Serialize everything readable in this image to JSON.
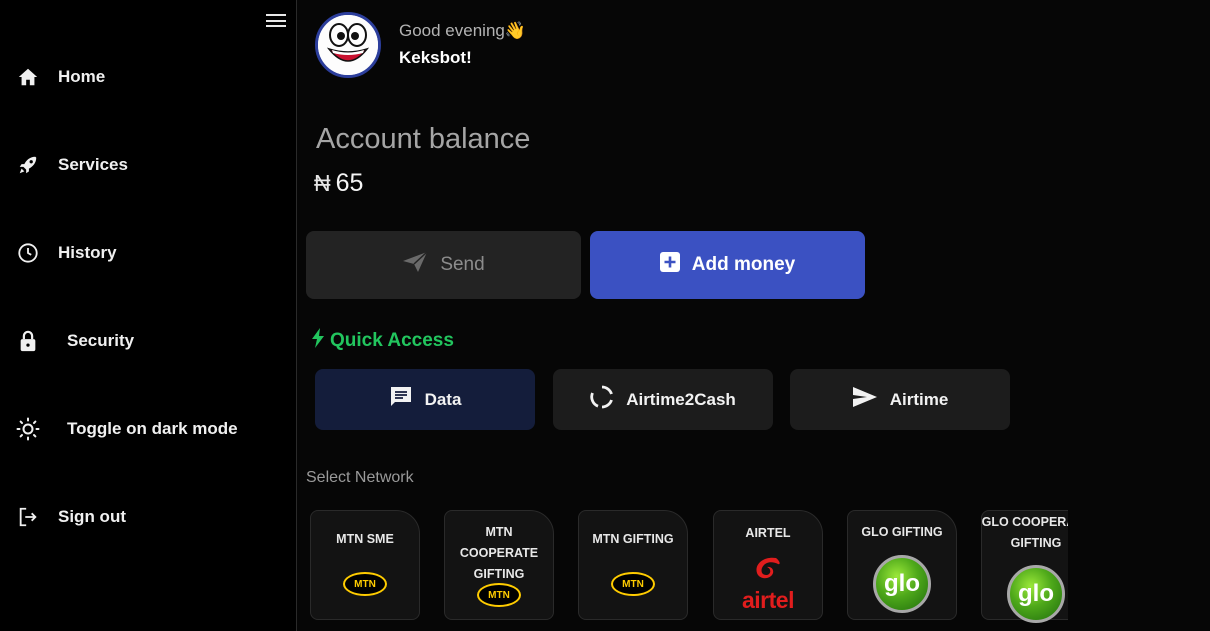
{
  "sidebar": {
    "items": [
      {
        "label": "Home",
        "icon": "home-icon"
      },
      {
        "label": "Services",
        "icon": "rocket-icon"
      },
      {
        "label": "History",
        "icon": "clock-icon"
      },
      {
        "label": "Security",
        "icon": "lock-icon"
      },
      {
        "label": "Toggle on dark mode",
        "icon": "sun-icon"
      },
      {
        "label": "Sign out",
        "icon": "sign-out-icon"
      }
    ]
  },
  "header": {
    "greeting": "Good evening",
    "greeting_emoji": "👋",
    "username": "Keksbot!"
  },
  "account": {
    "title": "Account balance",
    "currency_symbol": "₦",
    "balance": "65"
  },
  "actions": {
    "send_label": "Send",
    "add_money_label": "Add money"
  },
  "quick_access": {
    "title": "Quick Access",
    "items": [
      {
        "label": "Data",
        "icon": "message-icon"
      },
      {
        "label": "Airtime2Cash",
        "icon": "refresh-icon"
      },
      {
        "label": "Airtime",
        "icon": "send-icon"
      }
    ]
  },
  "network": {
    "title": "Select Network",
    "cards": [
      {
        "label": "MTN SME",
        "logo": "MTN"
      },
      {
        "label": "MTN COOPERATE GIFTING",
        "logo": "MTN"
      },
      {
        "label": "MTN GIFTING",
        "logo": "MTN"
      },
      {
        "label": "AIRTEL",
        "logo": "airtel"
      },
      {
        "label": "GLO GIFTING",
        "logo": "glo"
      },
      {
        "label": "GLO COOPERATE GIFTING",
        "logo": "glo"
      }
    ]
  },
  "colors": {
    "accent": "#3b51c2",
    "quick_access": "#22c55e",
    "mtn_yellow": "#ffcc00",
    "airtel_red": "#e11d1d",
    "glo_green": "#4ea81a"
  }
}
